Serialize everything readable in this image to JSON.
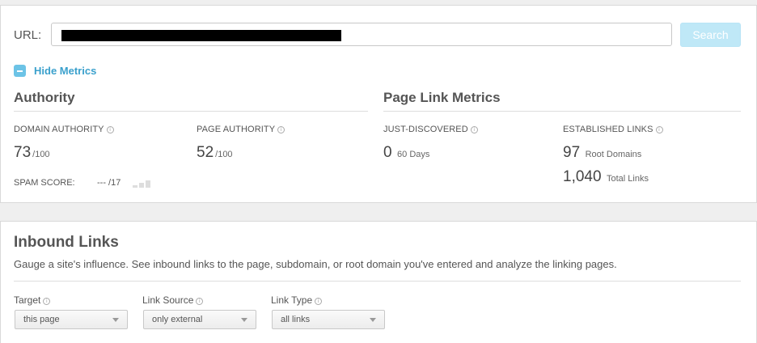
{
  "search": {
    "url_label": "URL:",
    "url_value": "",
    "button_label": "Search"
  },
  "metrics_toggle": {
    "label": "Hide Metrics"
  },
  "authority": {
    "title": "Authority",
    "domain_authority": {
      "label": "DOMAIN AUTHORITY",
      "value": "73",
      "unit": "/100"
    },
    "page_authority": {
      "label": "PAGE AUTHORITY",
      "value": "52",
      "unit": "/100"
    },
    "spam_score": {
      "label": "SPAM SCORE:",
      "value": "--- /17"
    }
  },
  "page_link_metrics": {
    "title": "Page Link Metrics",
    "just_discovered": {
      "label": "JUST-DISCOVERED",
      "value": "0",
      "unit": "60 Days"
    },
    "established_links": {
      "label": "ESTABLISHED LINKS",
      "root_domains_value": "97",
      "root_domains_unit": "Root Domains",
      "total_links_value": "1,040",
      "total_links_unit": "Total Links"
    }
  },
  "inbound_links": {
    "title": "Inbound Links",
    "description": "Gauge a site's influence. See inbound links to the page, subdomain, or root domain you've entered and analyze the linking pages.",
    "filters": {
      "target": {
        "label": "Target",
        "selected": "this page"
      },
      "link_source": {
        "label": "Link Source",
        "selected": "only external"
      },
      "link_type": {
        "label": "Link Type",
        "selected": "all links"
      }
    }
  },
  "colors": {
    "accent": "#3aa0cc",
    "search_button_bg": "#bfe8f7",
    "panel_bg": "#ffffff",
    "page_bg": "#efefef"
  }
}
